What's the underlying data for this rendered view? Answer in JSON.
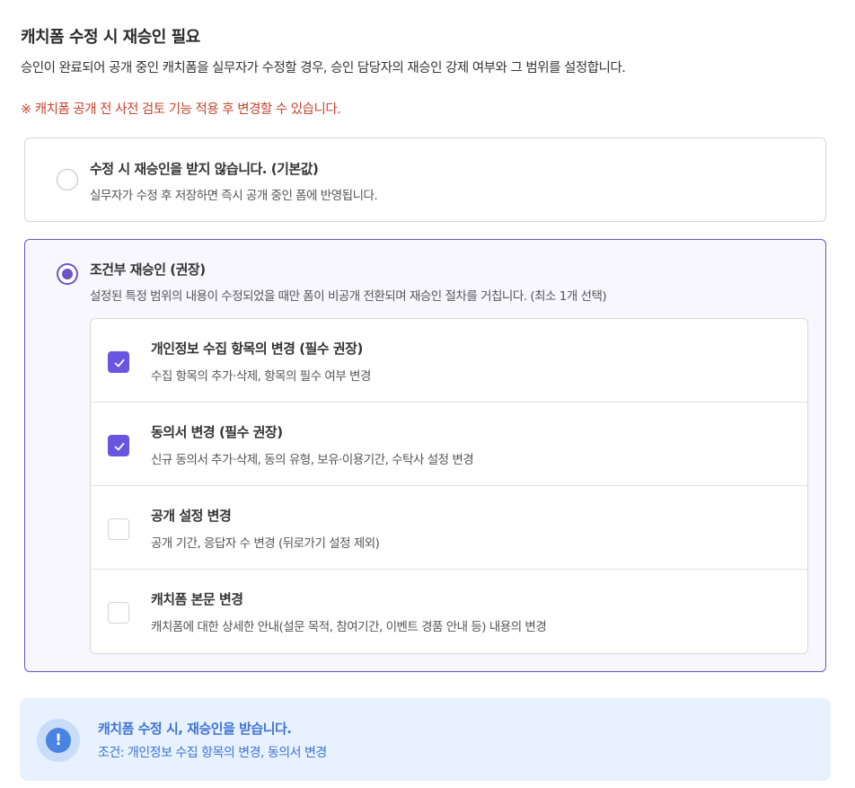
{
  "header": {
    "title": "캐치폼 수정 시 재승인 필요",
    "description": "승인이 완료되어 공개 중인 캐치폼을 실무자가 수정할 경우, 승인 담당자의 재승인 강제 여부와 그 범위를 설정합니다.",
    "warning": "※ 캐치폼 공개 전 사전 검토 기능 적용 후 변경할 수 있습니다."
  },
  "options": [
    {
      "title": "수정 시 재승인을 받지 않습니다. (기본값)",
      "description": "실무자가 수정 후 저장하면 즉시 공개 중인 폼에 반영됩니다.",
      "selected": false
    },
    {
      "title": "조건부 재승인 (권장)",
      "description": "설정된 특정 범위의 내용이 수정되었을 때만 폼이 비공개 전환되며 재승인 절차를 거칩니다. (최소 1개 선택)",
      "selected": true
    }
  ],
  "conditions": [
    {
      "title": "개인정보 수집 항목의 변경 (필수 권장)",
      "description": "수집 항목의 추가·삭제, 항목의 필수 여부 변경",
      "checked": true
    },
    {
      "title": "동의서 변경 (필수 권장)",
      "description": "신규 동의서 추가·삭제, 동의 유형, 보유·이용기간, 수탁사 설정 변경",
      "checked": true
    },
    {
      "title": "공개 설정 변경",
      "description": "공개 기간, 응답자 수 변경 (뒤로가기 설정 제외)",
      "checked": false
    },
    {
      "title": "캐치폼 본문 변경",
      "description": "캐치폼에 대한 상세한 안내(설문 목적, 참여기간, 이벤트 경품 안내 등) 내용의 변경",
      "checked": false
    }
  ],
  "notice": {
    "icon": "exclamation-icon",
    "icon_glyph": "!",
    "title": "캐치폼 수정 시, 재승인을 받습니다.",
    "description": "조건: 개인정보 수집 항목의 변경, 동의서 변경"
  },
  "colors": {
    "accent": "#6a55e0",
    "warning": "#c8442f",
    "notice_text": "#3f73d6",
    "notice_bg": "#e8f2fe"
  }
}
